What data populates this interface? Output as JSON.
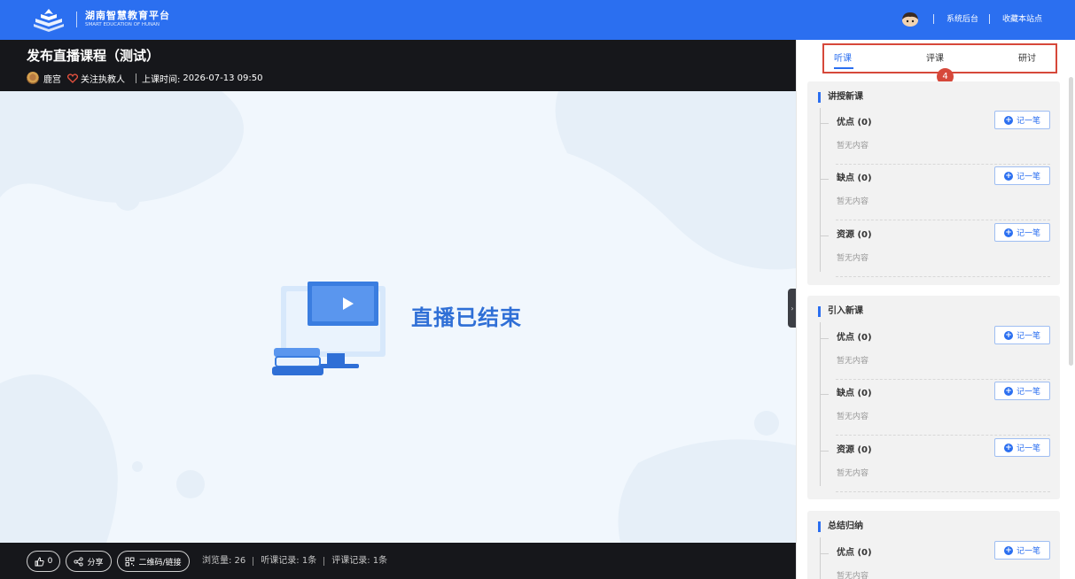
{
  "header": {
    "logo_cn": "湖南智慧教育平台",
    "logo_en": "SMART EDUCATION OF HUNAN",
    "links": [
      "系统后台",
      "收藏本站点"
    ]
  },
  "video": {
    "title": "发布直播课程（测试）",
    "teacher": "鹿宫",
    "follow": "关注执教人",
    "time_label": "上课时间:",
    "time_value": "2026-07-13 09:50",
    "ended": "直播已结束"
  },
  "footer": {
    "like_count": "0",
    "share": "分享",
    "qr": "二维码/链接",
    "views": "浏览量: 26",
    "listen_records": "听课记录: 1条",
    "review_records": "评课记录: 1条"
  },
  "panel": {
    "tabs": [
      "听课",
      "评课",
      "研讨"
    ],
    "active_tab": 0,
    "badge": "4",
    "note_label": "记一笔",
    "empty_text": "暂无内容",
    "sections": [
      {
        "title": "讲授新课",
        "items": [
          "优点 (0)",
          "缺点 (0)",
          "资源 (0)"
        ]
      },
      {
        "title": "引入新课",
        "items": [
          "优点 (0)",
          "缺点 (0)",
          "资源 (0)"
        ]
      },
      {
        "title": "总结归纳",
        "items": [
          "优点 (0)"
        ]
      }
    ]
  },
  "colors": {
    "brand_blue": "#2b6ff0",
    "dark_bg": "#16171b",
    "highlight_red": "#d6483a"
  }
}
